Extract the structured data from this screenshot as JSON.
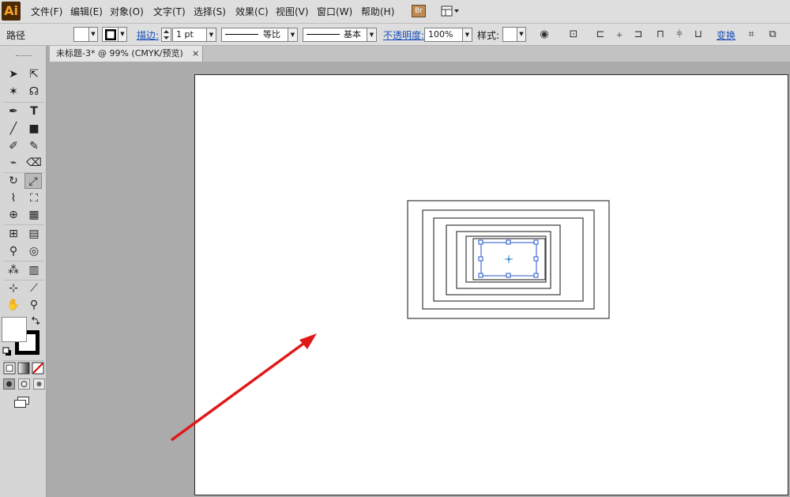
{
  "app": {
    "logo": "Ai"
  },
  "menu": [
    "文件(F)",
    "编辑(E)",
    "对象(O)",
    "文字(T)",
    "选择(S)",
    "效果(C)",
    "视图(V)",
    "窗口(W)",
    "帮助(H)"
  ],
  "bridge_label": "Br",
  "control": {
    "object_type": "路径",
    "stroke_label": "描边:",
    "stroke_weight": "1 pt",
    "profile_label": "等比",
    "brush_label": "基本",
    "opacity_label": "不透明度:",
    "opacity_value": "100%",
    "style_label": "样式:",
    "transform_label": "变换"
  },
  "document_tab": {
    "title": "未标题-3* @ 99% (CMYK/预览)",
    "close": "×"
  },
  "tools": [
    "selection-tool",
    "direct-selection-tool",
    "magic-wand-tool",
    "lasso-tool",
    "pen-tool",
    "type-tool",
    "line-tool",
    "rectangle-tool",
    "paintbrush-tool",
    "pencil-tool",
    "blob-brush-tool",
    "eraser-tool",
    "rotate-tool",
    "scale-tool",
    "warp-tool",
    "free-transform-tool",
    "shape-builder-tool",
    "perspective-grid-tool",
    "mesh-tool",
    "gradient-tool",
    "eyedropper-tool",
    "blend-tool",
    "symbol-sprayer-tool",
    "column-graph-tool",
    "artboard-tool",
    "slice-tool",
    "hand-tool",
    "zoom-tool"
  ],
  "colors": {
    "fill": "#ffffff",
    "stroke": "#000000",
    "arrow": "#e01818",
    "selection": "#2255cc"
  },
  "artwork": {
    "concentric_rectangles": 7,
    "selected_rectangle": "innermost"
  }
}
